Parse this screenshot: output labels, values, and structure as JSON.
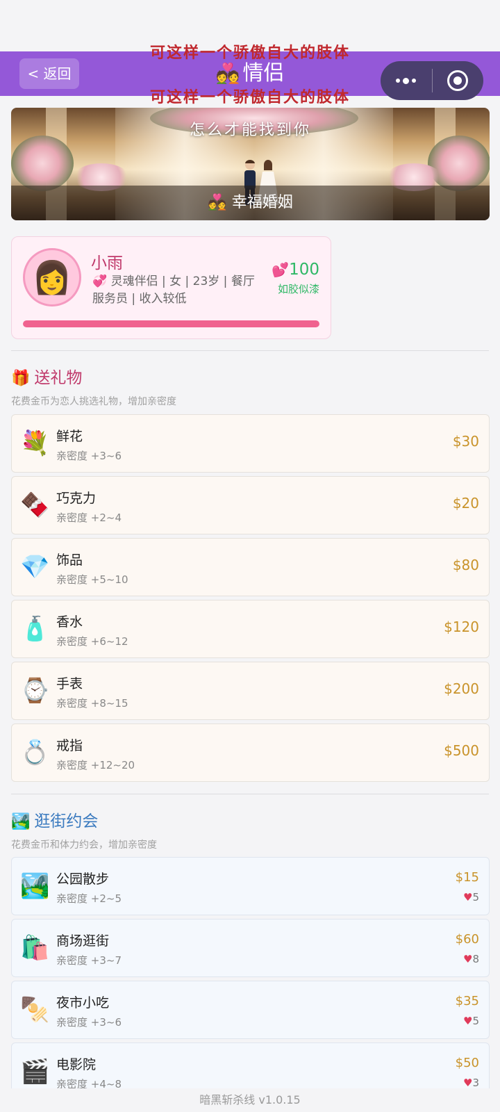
{
  "nav": {
    "back_label": "< 返回",
    "title_emoji": "💑",
    "title": "情侣",
    "capsule_more_icon": "more-dots-icon",
    "capsule_close_icon": "target-icon"
  },
  "overlay": {
    "line1": "可这样一个骄傲自大的肢体",
    "line2": "可这样一个骄傲自大的肢体"
  },
  "banner": {
    "script_text": "怎么才能找到你",
    "caption_emoji": "💑",
    "caption": "幸福婚姻"
  },
  "partner": {
    "avatar_emoji": "👩",
    "name": "小雨",
    "info_emoji": "💞",
    "info": "灵魂伴侣 | 女 | 23岁 | 餐厅服务员 | 收入较低",
    "affection_emoji": "💕",
    "affection": "100",
    "affection_level": "如胶似漆",
    "affection_progress": 1.0
  },
  "gifts": {
    "icon": "🎁",
    "title": "送礼物",
    "subtitle": "花费金币为恋人挑选礼物，增加亲密度",
    "items": [
      {
        "icon": "💐",
        "name": "鲜花",
        "desc": "亲密度 +3~6",
        "price": "$30"
      },
      {
        "icon": "🍫",
        "name": "巧克力",
        "desc": "亲密度 +2~4",
        "price": "$20"
      },
      {
        "icon": "💎",
        "name": "饰品",
        "desc": "亲密度 +5~10",
        "price": "$80"
      },
      {
        "icon": "🧴",
        "name": "香水",
        "desc": "亲密度 +6~12",
        "price": "$120"
      },
      {
        "icon": "⌚",
        "name": "手表",
        "desc": "亲密度 +8~15",
        "price": "$200"
      },
      {
        "icon": "💍",
        "name": "戒指",
        "desc": "亲密度 +12~20",
        "price": "$500"
      }
    ]
  },
  "dates": {
    "icon": "🏞️",
    "title": "逛街约会",
    "subtitle": "花费金币和体力约会，增加亲密度",
    "items": [
      {
        "icon": "🏞️",
        "name": "公园散步",
        "desc": "亲密度 +2~5",
        "price": "$15",
        "stamina_icon": "♥",
        "stamina": "5"
      },
      {
        "icon": "🛍️",
        "name": "商场逛街",
        "desc": "亲密度 +3~7",
        "price": "$60",
        "stamina_icon": "♥",
        "stamina": "8"
      },
      {
        "icon": "🍢",
        "name": "夜市小吃",
        "desc": "亲密度 +3~6",
        "price": "$35",
        "stamina_icon": "♥",
        "stamina": "5"
      },
      {
        "icon": "🎬",
        "name": "电影院",
        "desc": "亲密度 +4~8",
        "price": "$50",
        "stamina_icon": "♥",
        "stamina": "3"
      }
    ]
  },
  "footer": {
    "version": "暗黑斩杀线 v1.0.15"
  },
  "colors": {
    "nav_bg": "#9458d8",
    "accent_pink": "#f0628f",
    "price_gold": "#c9932a",
    "affection_green": "#2fb866",
    "section_gift": "#c0396b",
    "section_date": "#3a7abf"
  }
}
